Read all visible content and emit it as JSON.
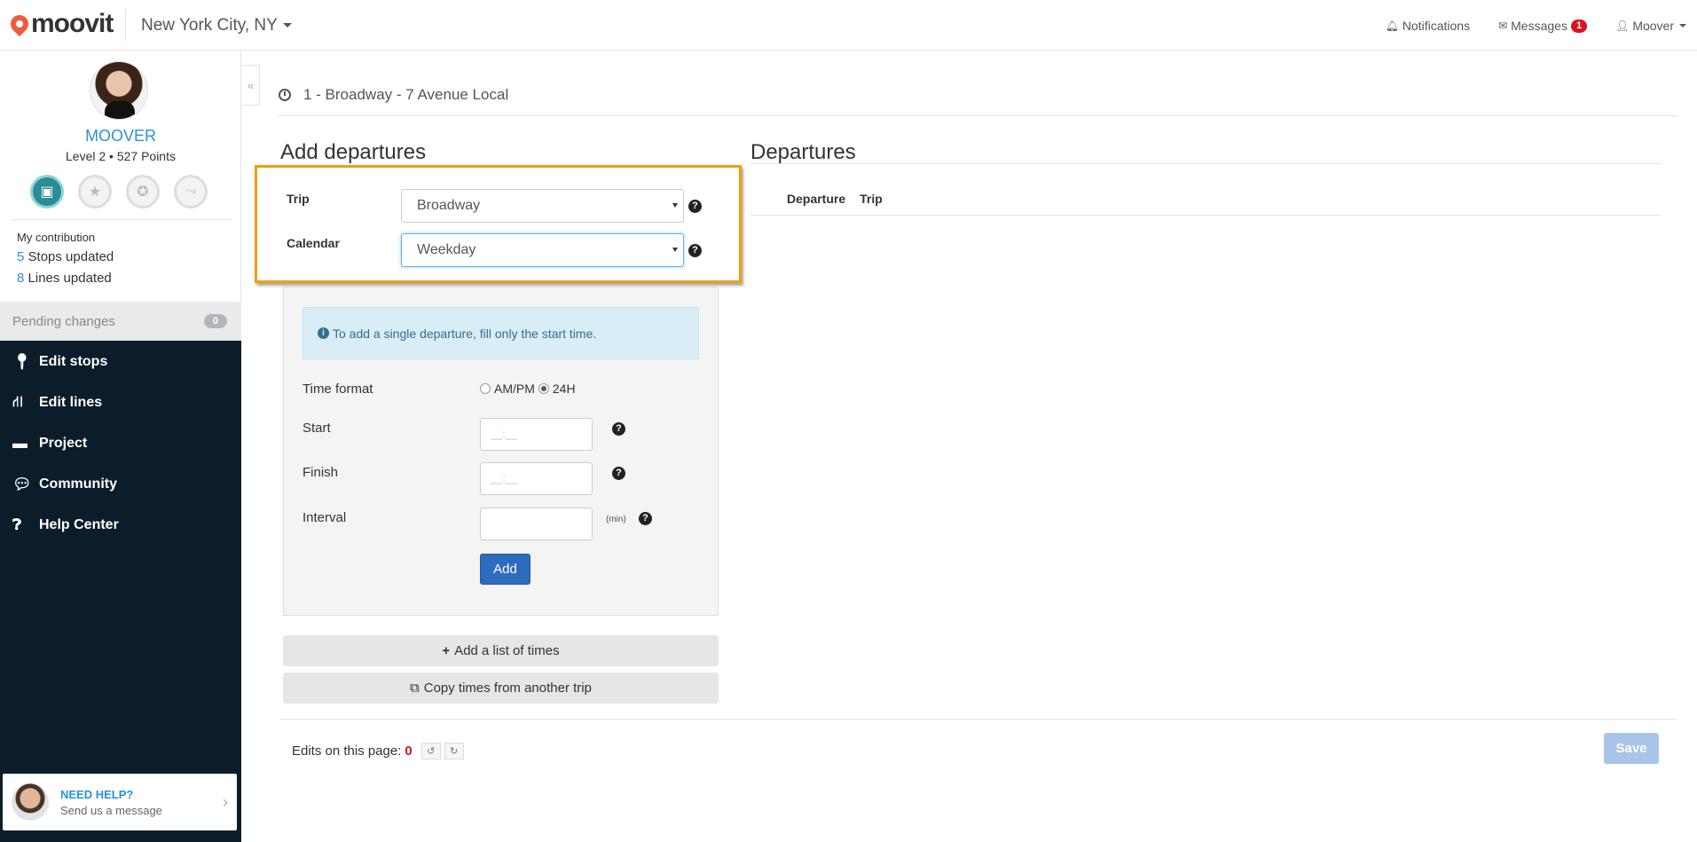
{
  "header": {
    "logo_text": "moovit",
    "city": "New York City, NY",
    "notifications_label": "Notifications",
    "messages_label": "Messages",
    "messages_badge": "1",
    "user_label": "Moover"
  },
  "sidebar": {
    "username": "MOOVER",
    "level_text": "Level 2 • 527 Points",
    "contribution_title": "My contribution",
    "stops_count": "5",
    "stops_label": "Stops updated",
    "lines_count": "8",
    "lines_label": "Lines updated",
    "pending_label": "Pending changes",
    "pending_count": "0",
    "nav": [
      {
        "label": "Edit stops",
        "icon": "map-pin-icon"
      },
      {
        "label": "Edit lines",
        "icon": "road-icon"
      },
      {
        "label": "Project",
        "icon": "folder-icon"
      },
      {
        "label": "Community",
        "icon": "chat-bubble-icon"
      },
      {
        "label": "Help Center",
        "icon": "question-circle-icon"
      }
    ],
    "help": {
      "title": "NEED HELP?",
      "subtitle": "Send us a message"
    }
  },
  "main": {
    "breadcrumb": "1 - Broadway - 7 Avenue Local",
    "add_title": "Add departures",
    "departures_title": "Departures",
    "trip_label": "Trip",
    "trip_value": "Broadway",
    "calendar_label": "Calendar",
    "calendar_value": "Weekday",
    "info_text": "To add a single departure, fill only the start time.",
    "time_format_label": "Time format",
    "ampm_label": "AM/PM",
    "h24_label": "24H",
    "start_label": "Start",
    "finish_label": "Finish",
    "interval_label": "Interval",
    "time_placeholder": "__:__",
    "min_unit": "(min)",
    "add_button": "Add",
    "add_list_button": "Add a list of times",
    "copy_button": "Copy times from another trip",
    "table_headers": [
      "Departure",
      "Trip"
    ],
    "edits_label": "Edits on this page:",
    "edits_count": "0",
    "save_button": "Save"
  },
  "colors": {
    "accent": "#2a91d8",
    "nav_bg": "#0b1d2b",
    "highlight": "#f0a00a",
    "primary_button": "#2f6cbd",
    "badge": "#d9131f"
  }
}
